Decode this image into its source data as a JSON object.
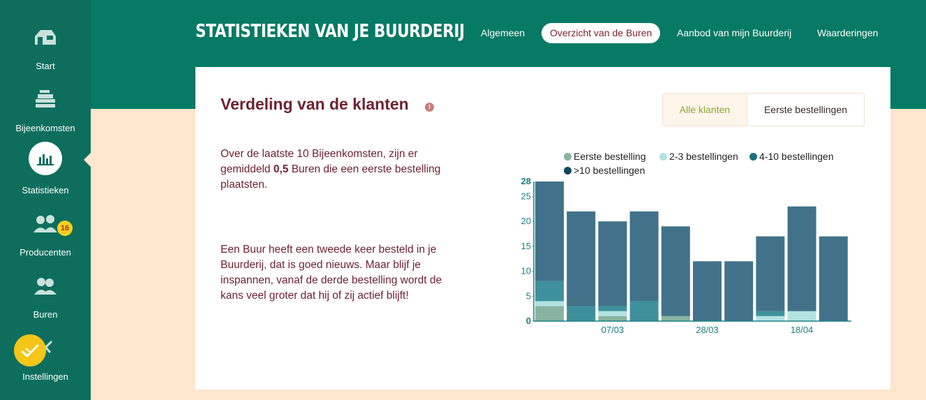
{
  "sidebar": {
    "items": [
      {
        "label": "Start",
        "icon": "farm-icon"
      },
      {
        "label": "Bijeenkomsten",
        "icon": "crates-icon"
      },
      {
        "label": "Statistieken",
        "icon": "bar-chart-icon"
      },
      {
        "label": "Producenten",
        "icon": "producers-icon"
      },
      {
        "label": "Buren",
        "icon": "neighbours-icon"
      },
      {
        "label": "Instellingen",
        "icon": "tools-icon"
      }
    ],
    "producers_badge": "16",
    "colors": {
      "background": "#0d6e5d",
      "badge": "#f5d11b"
    }
  },
  "header": {
    "title": "STATISTIEKEN VAN JE BUURDERIJ",
    "tabs": [
      {
        "label": "Algemeen"
      },
      {
        "label": "Overzicht van de Buren"
      },
      {
        "label": "Aanbod van mijn Buurderij"
      },
      {
        "label": "Waarderingen"
      }
    ],
    "active_tab": "Overzicht van de Buren"
  },
  "card": {
    "title": "Verdeling van de klanten",
    "info_icon": "i",
    "toggle": {
      "options": [
        "Alle klanten",
        "Eerste bestellingen"
      ],
      "selected": "Alle klanten"
    },
    "paragraph1_pre": "Over de laatste 10 Bijeenkomsten, zijn er gemiddeld ",
    "paragraph1_bold": "0,5",
    "paragraph1_post": " Buren die een eerste bestelling plaatsten.",
    "paragraph2": "Een Buur heeft een tweede keer besteld in je Buurderij, dat is goed nieuws. Maar blijf je inspannen, vanaf de derde bestelling wordt de kans veel groter dat hij of zij actief blijft!"
  },
  "chart_data": {
    "type": "bar",
    "stacked": true,
    "categories": [
      "",
      "",
      "07/03",
      "",
      "",
      "28/03",
      "",
      "",
      "18/04",
      ""
    ],
    "series": [
      {
        "name": "Eerste bestelling",
        "color": "#88b3a1",
        "values": [
          3,
          0,
          1,
          0,
          1,
          0,
          0,
          0,
          0,
          0
        ]
      },
      {
        "name": "2-3 bestellingen",
        "color": "#b1e3e2",
        "values": [
          1,
          0,
          1,
          0,
          0,
          0,
          0,
          1,
          2,
          0
        ]
      },
      {
        "name": "4-10 bestellingen",
        "color": "#3e919b",
        "values": [
          4,
          3,
          1,
          4,
          0,
          0,
          0,
          1,
          0,
          0
        ]
      },
      {
        "name": ">10 bestellingen",
        "color": "#41728a",
        "values": [
          20,
          19,
          17,
          18,
          18,
          12,
          12,
          15,
          21,
          17
        ]
      }
    ],
    "yticks": [
      0,
      5,
      10,
      15,
      20,
      25
    ],
    "ymax_label": "28",
    "ylim": [
      0,
      28
    ],
    "axis_color": "#1a7f83"
  }
}
